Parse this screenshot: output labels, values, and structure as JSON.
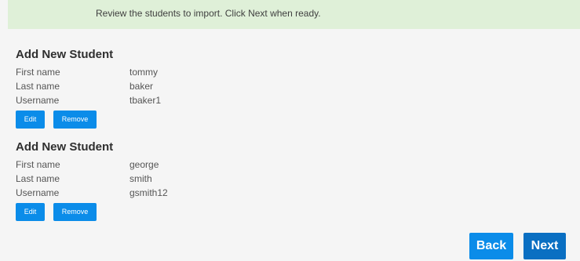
{
  "banner": {
    "message": "Review the students to import. Click Next when ready."
  },
  "students": [
    {
      "heading": "Add New Student",
      "first_name_label": "First name",
      "first_name": "tommy",
      "last_name_label": "Last name",
      "last_name": "baker",
      "username_label": "Username",
      "username": "tbaker1",
      "edit_label": "Edit",
      "remove_label": "Remove"
    },
    {
      "heading": "Add New Student",
      "first_name_label": "First name",
      "first_name": "george",
      "last_name_label": "Last name",
      "last_name": "smith",
      "username_label": "Username",
      "username": "gsmith12",
      "edit_label": "Edit",
      "remove_label": "Remove"
    }
  ],
  "navigation": {
    "back_label": "Back",
    "next_label": "Next"
  },
  "colors": {
    "banner_background": "#dff0d8",
    "primary_button": "#0b8ce9",
    "next_button": "#0a6fc2"
  }
}
